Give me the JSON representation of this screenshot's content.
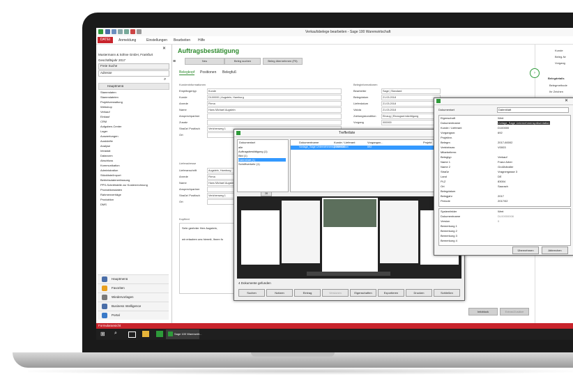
{
  "window": {
    "title": "Verkaufsbelege bearbeiten - Sage 100 Warenwirtschaft"
  },
  "menubar": {
    "items": [
      "DATEI",
      "Anmeldung",
      "Einstellungen",
      "Bearbeiten",
      "Hilfe"
    ]
  },
  "leftnav": {
    "company": "Mustermann & Söhne GmbH, Frankfurt",
    "fiscal_year": "Geschäftsjahr 2017",
    "search_label": "Freie Suche",
    "search_value": "Adresse",
    "menu_header": "Hauptmenü",
    "tree": [
      "Stammdaten",
      "Stammdateien",
      "Projektverwaltung",
      "Webshop",
      "Verkauf",
      "Einkauf",
      "CRM",
      "Aufgaben-Center",
      "Lager",
      "Auswertungen",
      "Auskünfte",
      "Analyse",
      "Intrastat",
      "Datanorm",
      "Abschluss",
      "Kommunikation",
      "Administration",
      "Stückliste/Import",
      "Betriebsdatenerfassung",
      "PPS-Schnittstelle zur Kostenrechnung",
      "Produktionsdaten",
      "Rahmenverträge",
      "Produktion",
      "DMS"
    ],
    "buttons": [
      "Hauptmenü",
      "Favoriten",
      "Wiedervorlagen",
      "Business Intelligence",
      "Portal"
    ]
  },
  "form": {
    "title": "Auftragsbestätigung",
    "toolbar": [
      "Neu",
      "Beleg suchen",
      "Beleg übernehmen (F5)"
    ],
    "tabs": [
      "Belegkopf",
      "Positionen",
      "Belegfuß"
    ],
    "sections": {
      "kunde": "Kundeninformationen",
      "liefer": "Lieferadresse",
      "beleg": "Beleginformationen",
      "kopftext": "Kopftext"
    },
    "kunde_labels": [
      "Empfängertyp",
      "Kunde",
      "Anrede",
      "Name",
      "Ansprechpartner",
      "Zusatz",
      "Straße/ Postfach",
      "Ort"
    ],
    "kunde_values": [
      "Kunde",
      "D100000 | Augstein, Hamburg",
      "Firma",
      "Hans Michael Augstein",
      "",
      "",
      "Verichenweg 1",
      ""
    ],
    "liefer_labels": [
      "Lieferanschrift",
      "Anrede",
      "Name",
      "Ansprechpartner",
      "Straße/ Postfach",
      "Ort"
    ],
    "liefer_values": [
      "Augstein, Hamburg",
      "Firma",
      "Hans Michael Augstein",
      "",
      "Verichenweg 1",
      ""
    ],
    "beleg_labels": [
      "Bearbeiter",
      "Belegdatum",
      "Lieferdatum",
      "Valuta",
      "Zahlungskondition",
      "Vorgang"
    ],
    "beleg_values": [
      "Sage | Standard",
      "21.03.2018",
      "21.03.2018",
      "21.03.2018",
      "Einzug | Einzugsermächtigung",
      "000000"
    ],
    "kopftext_line1": "Sehr geehrter Herr Augstein,",
    "kopftext_line2": "wir erlauben uns hiermit, Ihnen fo",
    "bottom_buttons": [
      "Infoblock",
      "Extras/Zusätze"
    ]
  },
  "rightpanel": {
    "items": [
      "Kunde",
      "Beleg-Nr",
      "Vorgang"
    ],
    "belegdetails": "Belegdetails",
    "detail_items": [
      "Belegmethode",
      "Ihr Zeichen"
    ]
  },
  "trefferliste": {
    "title": "Trefferliste",
    "col_header": "Dokumentart",
    "doc_types": [
      "alle",
      "Auftragsbestätigung (1)",
      "Bild (1)",
      "Datenblatt (1)",
      "Schriftverkehr (1)"
    ],
    "result_headers": [
      "Dokumentname",
      "Kunde / Lieferant",
      "Vorgangsn...",
      "Projekt"
    ],
    "result_row": [
      "Vorlage_Sage Unternehmenspräsentation",
      "D100000",
      "692",
      ""
    ],
    "page_count": "28",
    "found": "4 Dokumente gefunden",
    "buttons": [
      "Suchen",
      "Notizen",
      "Eintrag",
      "Versionen",
      "Eigenschaften",
      "Exportieren",
      "Drucken",
      "Schließen"
    ]
  },
  "datenblatt": {
    "dokumentart_label": "Dokumentart",
    "dokumentart_value": "Datenblatt",
    "prop_header": "Eigenschaft",
    "value_header": "Wert",
    "props": [
      "Dokumentname",
      "Kunde / Lieferant",
      "Vorgangsnr.",
      "Projektnr.",
      "Belegnr.",
      "Vertriebsmr.",
      "Mitarbeiternr.",
      "Belegtyp",
      "Name 1",
      "Name 2",
      "Straße",
      "Land",
      "PLZ",
      "Ort",
      "Belegdatum",
      "Belegjahr",
      "Periode"
    ],
    "values": [
      "Vorlage_Sage Unternehmenspräsentation",
      "D100000",
      "692",
      "",
      "2017-60002",
      "V0003",
      "",
      "Verkauf",
      "Franz Arber",
      "Großhändler",
      "Vragnergasse 3",
      "DE",
      "83004",
      "Saurach",
      "",
      "2017",
      "2017/02"
    ],
    "system_header": "Systemfelder",
    "system_props": [
      "Dokumentname",
      "Version",
      "Bemerkung 1",
      "Bemerkung 2",
      "Bemerkung 3",
      "Bemerkung 4"
    ],
    "system_values": [
      "DL00000008",
      "0",
      "",
      "",
      "",
      ""
    ],
    "buttons": [
      "Übernehmen",
      "Abbrechen"
    ]
  },
  "statusbar": {
    "text": "Formularansicht"
  },
  "taskbar": {
    "app": "Sage 100 Warenwirt..."
  }
}
